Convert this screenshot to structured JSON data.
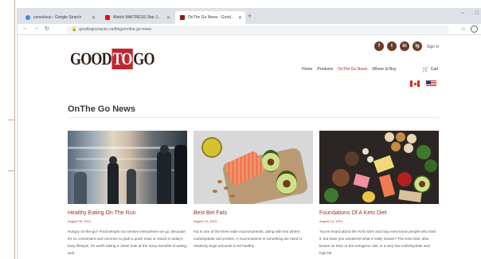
{
  "browser": {
    "tabs": [
      {
        "title": "consolous - Google Search",
        "favicon_color": "#4285f4",
        "active": false
      },
      {
        "title": "Watch WAITRESS Star Jessi...",
        "favicon_color": "#ff0000",
        "active": false
      },
      {
        "title": "OnThe Go News - GoodTo Go",
        "favicon_color": "#8b1a1a",
        "active": true
      }
    ],
    "new_tab_label": "+",
    "window_controls": [
      "–",
      "□"
    ],
    "url": "goodtogosnacks.ca/blogs/onthe-go-news"
  },
  "site": {
    "logo": {
      "good": "GOOD",
      "to": "TO",
      "go": "GO"
    },
    "socials": [
      "f",
      "t",
      "in",
      "ig"
    ],
    "signin": "Sign in",
    "nav": [
      {
        "label": "Home",
        "active": false
      },
      {
        "label": "Products",
        "active": false
      },
      {
        "label": "OnThe Go News",
        "active": true
      },
      {
        "label": "Where to Buy",
        "active": false
      }
    ],
    "cart_label": "Cart",
    "flags": [
      "Canada",
      "United States"
    ]
  },
  "main": {
    "section_title": "OnThe Go News",
    "articles": [
      {
        "title": "Healthy Eating On The Run",
        "date": "August 06, 2019",
        "excerpt": "Hungry on-the-go? Food tempts our senses everywhere we go. Because it's so convenient and common to grab a quick meal or snack in today's busy lifestyle, it's worth taking a closer look at the many benefits of eating well",
        "image": "crowd-motion-photo"
      },
      {
        "title": "Best Bet Fats",
        "date": "August 14, 2019",
        "excerpt": "Fat is one of the three main macronutrients, along with two others: carbohydrate and protein. A macronutrient is something we need in relatively large amounts to be healthy.",
        "image": "healthy-fats-photo"
      },
      {
        "title": "Foundations Of A Keto Diet",
        "date": "August 14, 2019",
        "excerpt": "You've heard about the 'Keto Diet' and may even know people who tried it, but have you wondered what it really means? The Keto Diet, also known as Keto or the Ketogenic diet, is a very low-carbohydrate and high-fat",
        "image": "keto-foods-photo"
      }
    ]
  },
  "colors": {
    "brand_red": "#c1272d",
    "brand_brown": "#6a3a2a",
    "article_title": "#8a3a2a"
  }
}
